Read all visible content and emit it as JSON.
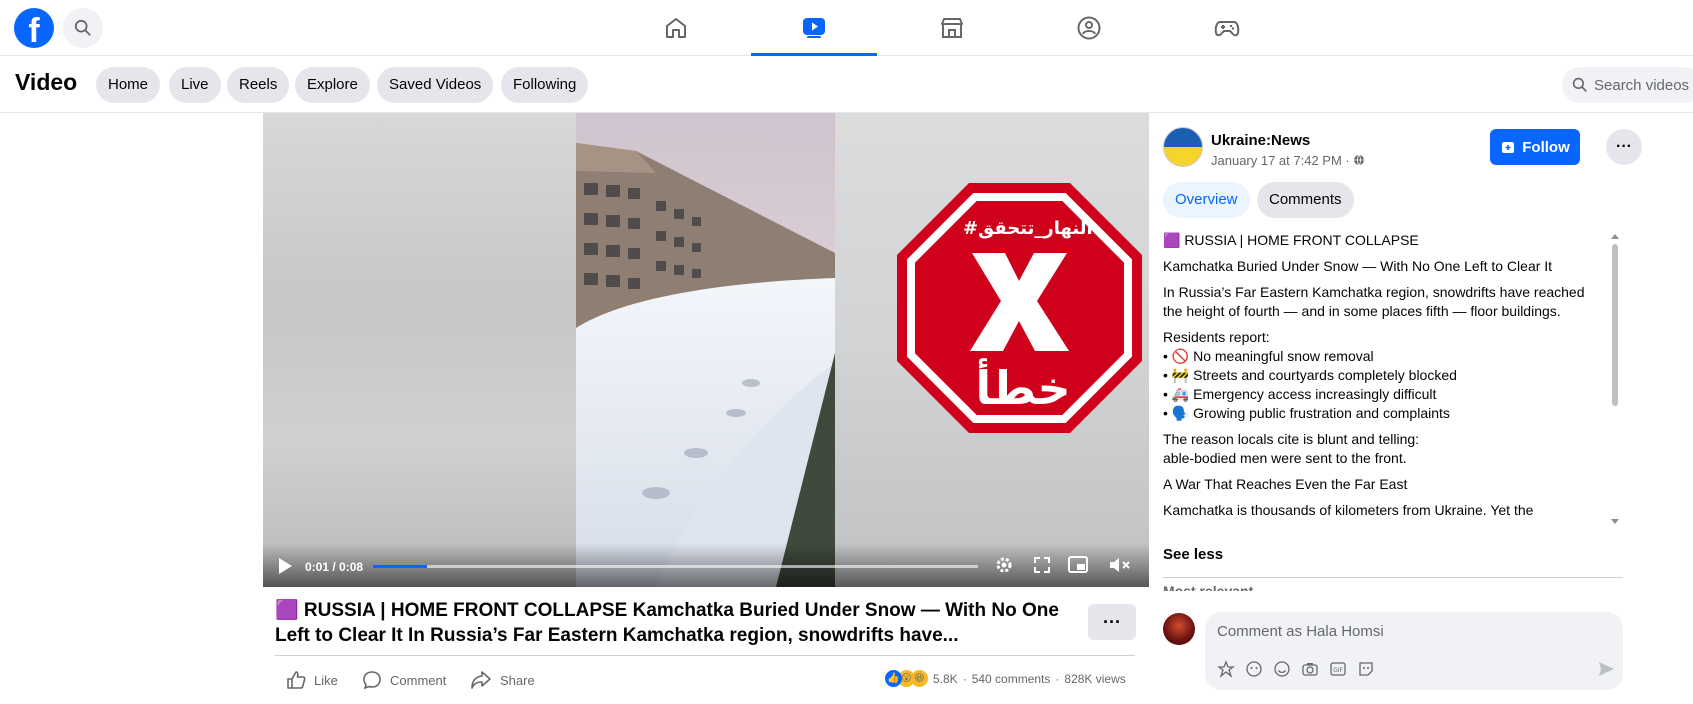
{
  "topbar": {
    "logo": "f",
    "search_icon": "search-icon",
    "nav": [
      {
        "name": "home-icon",
        "active": false
      },
      {
        "name": "video-icon",
        "active": true
      },
      {
        "name": "marketplace-icon",
        "active": false
      },
      {
        "name": "groups-icon",
        "active": false
      },
      {
        "name": "gaming-icon",
        "active": false
      }
    ]
  },
  "subbar": {
    "title": "Video",
    "pills": [
      "Home",
      "Live",
      "Reels",
      "Explore",
      "Saved Videos",
      "Following"
    ],
    "search_placeholder": "Search videos"
  },
  "video": {
    "time": "0:01 / 0:08",
    "progress": 0.09,
    "overlay_text_top": "#النهار_تتحقق",
    "overlay_text_bottom": "خطأ"
  },
  "post": {
    "title": "🟪 RUSSIA | HOME FRONT COLLAPSE Kamchatka Buried Under Snow — With No One Left to Clear It In Russia’s Far Eastern Kamchatka region, snowdrifts have...",
    "actions": {
      "like": "Like",
      "comment": "Comment",
      "share": "Share"
    },
    "reactions_count": "5.8K",
    "comments": "540 comments",
    "views": "828K views"
  },
  "side": {
    "page_name": "Ukraine:News",
    "date": "January 17 at 7:42 PM · ",
    "follow": "Follow",
    "tabs": [
      "Overview",
      "Comments"
    ],
    "desc": [
      "🟪 RUSSIA | HOME FRONT COLLAPSE",
      "Kamchatka Buried Under Snow — With No One Left to Clear It",
      "In Russia’s Far Eastern Kamchatka region, snowdrifts have reached",
      "the height of fourth — and in some places fifth — floor buildings.",
      "Residents report:",
      "• 🚫 No meaningful snow removal",
      "• 🚧 Streets and courtyards completely blocked",
      "• 🚑 Emergency access increasingly difficult",
      "• 🗣️ Growing public frustration and complaints",
      "The reason locals cite is blunt and telling:",
      "able-bodied men were sent to the front.",
      "A War That Reaches Even the Far East",
      "Kamchatka is thousands of kilometers from Ukraine. Yet the"
    ],
    "see_less": "See less",
    "most_relevant": "Most relevant",
    "comment_placeholder": "Comment as Hala Homsi"
  },
  "colors": {
    "accent": "#0866ff",
    "stop_red": "#d0021b"
  }
}
